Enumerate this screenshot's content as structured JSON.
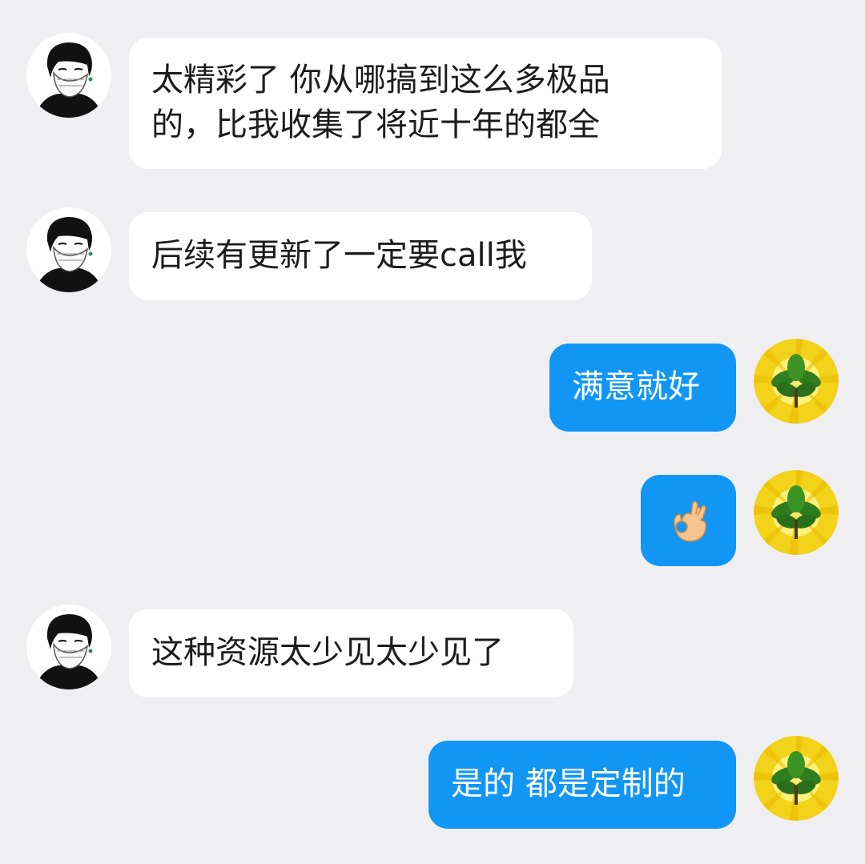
{
  "chat": {
    "messages": [
      {
        "side": "left",
        "avatar": "masked-person-avatar",
        "lines": [
          "太精彩了 你从哪搞到这么多极品",
          "的，比我收集了将近十年的都全"
        ]
      },
      {
        "side": "left",
        "avatar": "masked-person-avatar",
        "text": "后续有更新了一定要call我"
      },
      {
        "side": "right",
        "avatar": "green-leaf-avatar",
        "text": "满意就好"
      },
      {
        "side": "right",
        "avatar": "green-leaf-avatar",
        "emoji": "ok-hand-emoji"
      },
      {
        "side": "left",
        "avatar": "masked-person-avatar",
        "text": "这种资源太少见太少见了"
      },
      {
        "side": "right",
        "avatar": "green-leaf-avatar",
        "text": "是的 都是定制的"
      }
    ]
  },
  "colors": {
    "background": "#efeff2",
    "incoming_bubble": "#ffffff",
    "outgoing_bubble": "#1296f6",
    "incoming_text": "#1c1c1c",
    "outgoing_text": "#ffffff"
  }
}
